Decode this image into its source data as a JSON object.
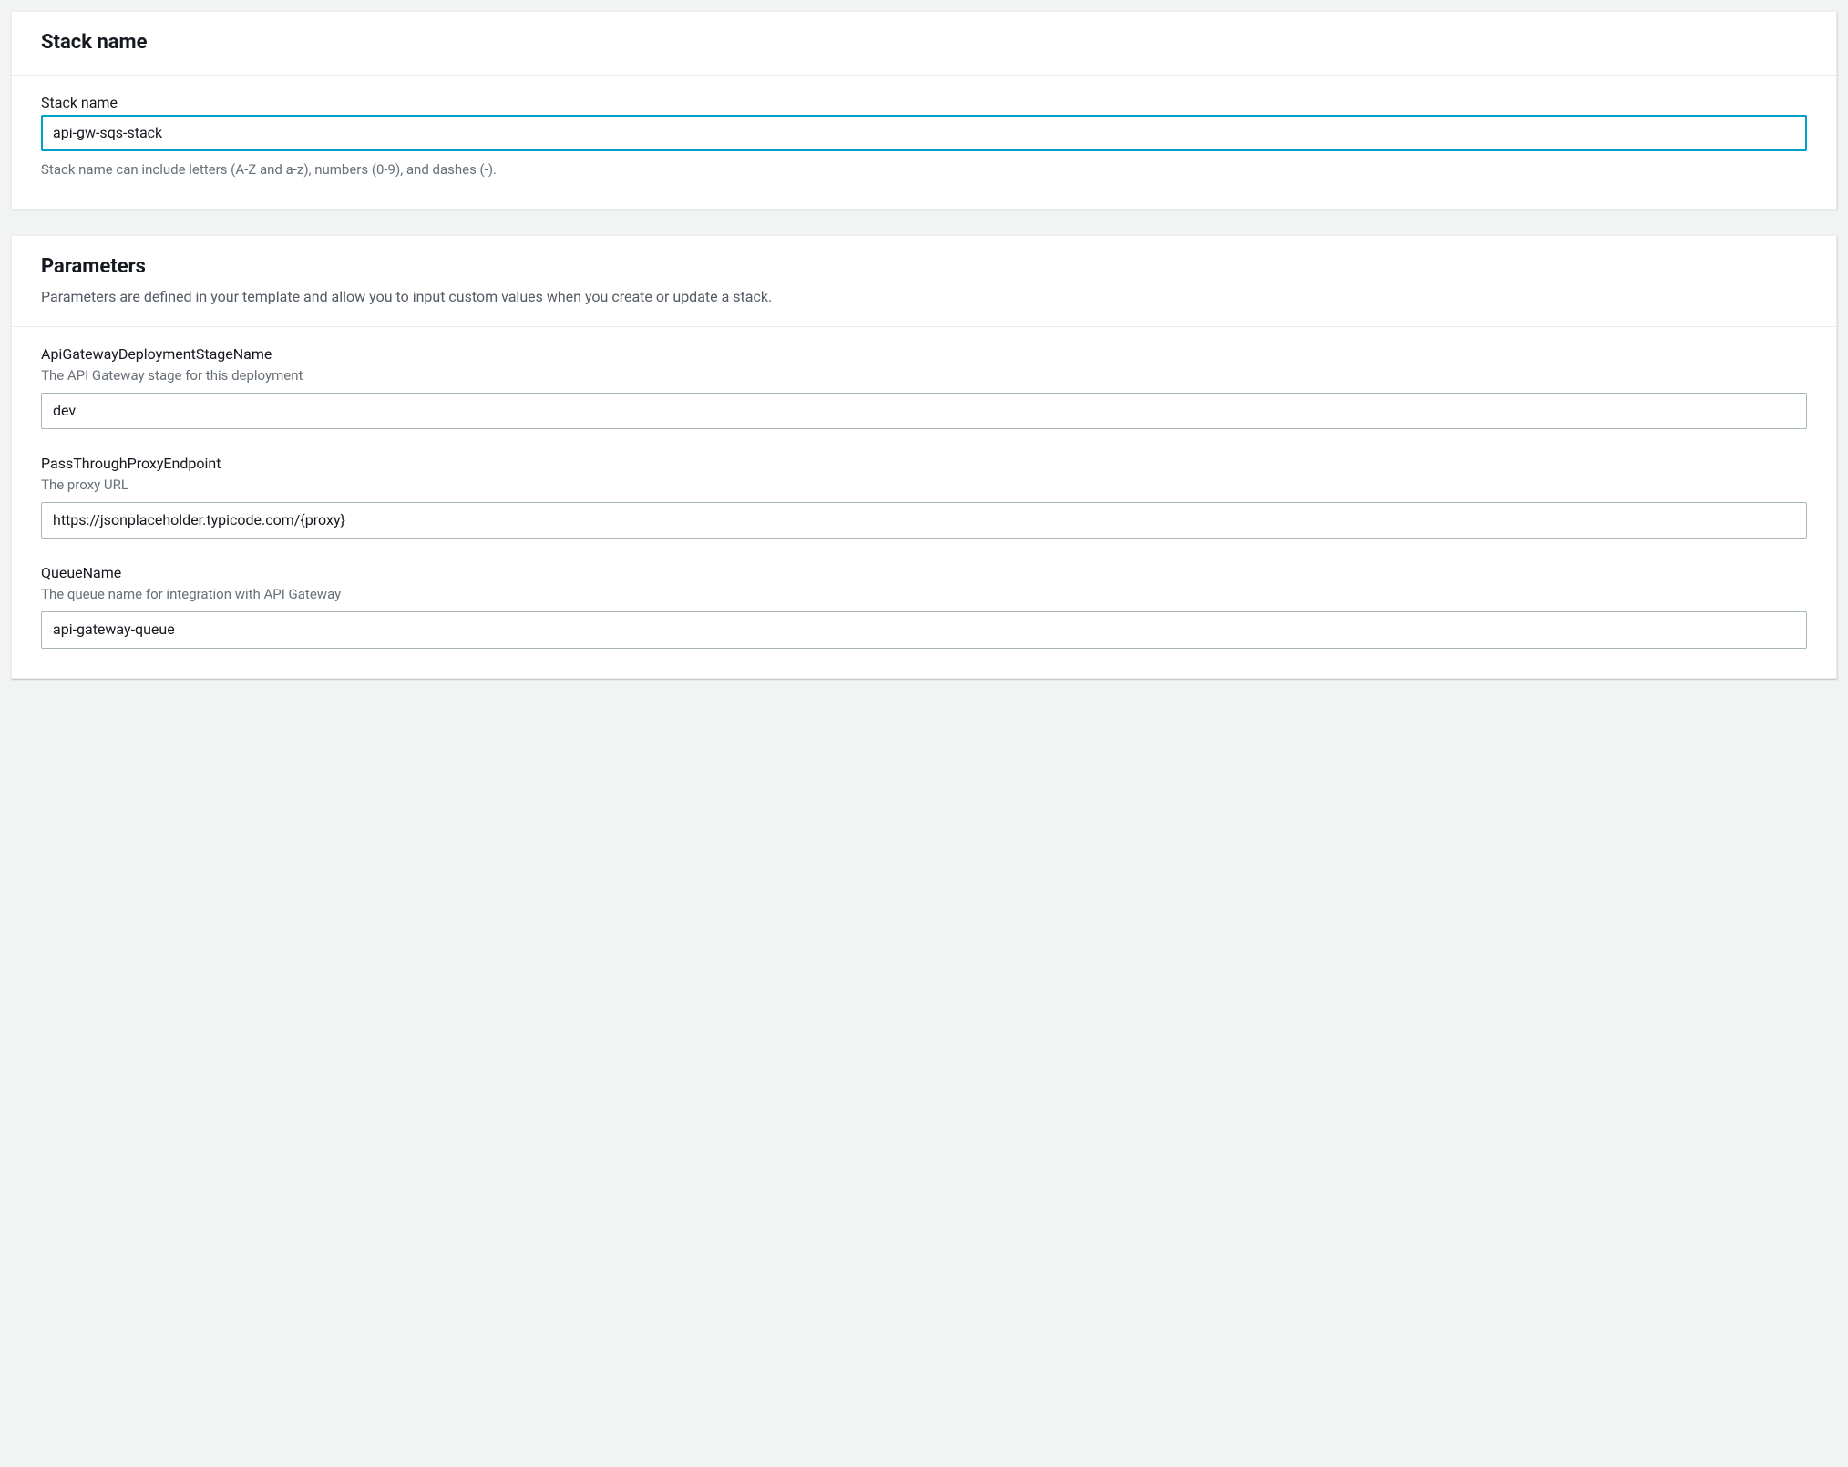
{
  "stackNamePanel": {
    "title": "Stack name",
    "field": {
      "label": "Stack name",
      "value": "api-gw-sqs-stack",
      "help": "Stack name can include letters (A-Z and a-z), numbers (0-9), and dashes (-)."
    }
  },
  "parametersPanel": {
    "title": "Parameters",
    "subtitle": "Parameters are defined in your template and allow you to input custom values when you create or update a stack.",
    "fields": [
      {
        "label": "ApiGatewayDeploymentStageName",
        "description": "The API Gateway stage for this deployment",
        "value": "dev"
      },
      {
        "label": "PassThroughProxyEndpoint",
        "description": "The proxy URL",
        "value": "https://jsonplaceholder.typicode.com/{proxy}"
      },
      {
        "label": "QueueName",
        "description": "The queue name for integration with API Gateway",
        "value": "api-gateway-queue"
      }
    ]
  }
}
